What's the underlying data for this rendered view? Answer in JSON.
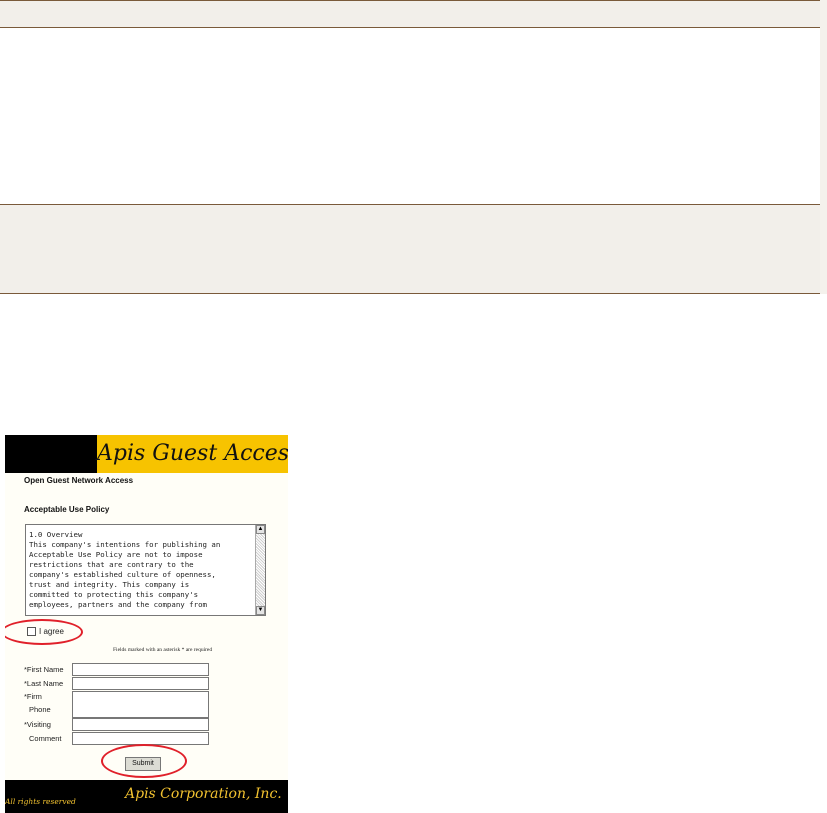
{
  "banner": {
    "title": "Apis Guest Access"
  },
  "form": {
    "heading": "Open Guest Network Access",
    "policy_heading": "Acceptable Use Policy",
    "policy_text": "1.0 Overview\nThis company's intentions for publishing an\nAcceptable Use Policy are not to impose\nrestrictions that are contrary to the\ncompany's established culture of openness,\ntrust and integrity. This company is\ncommitted to protecting this company's\nemployees, partners and the company from",
    "agree_label": "I agree",
    "required_note": "Fields marked with an asterisk * are required",
    "fields": {
      "first_name": "*First Name",
      "last_name": "*Last Name",
      "firm": "*Firm",
      "phone": "Phone",
      "visiting": "*Visiting",
      "comment": "Comment"
    },
    "submit_label": "Submit"
  },
  "footer": {
    "rights": "All rights reserved",
    "corporation": "Apis Corporation, Inc."
  },
  "colors": {
    "banner_yellow": "#f7c300",
    "banner_black": "#000000",
    "highlight_red": "#e0202a",
    "footer_text": "#f2c230",
    "table_band": "#f2efea"
  }
}
